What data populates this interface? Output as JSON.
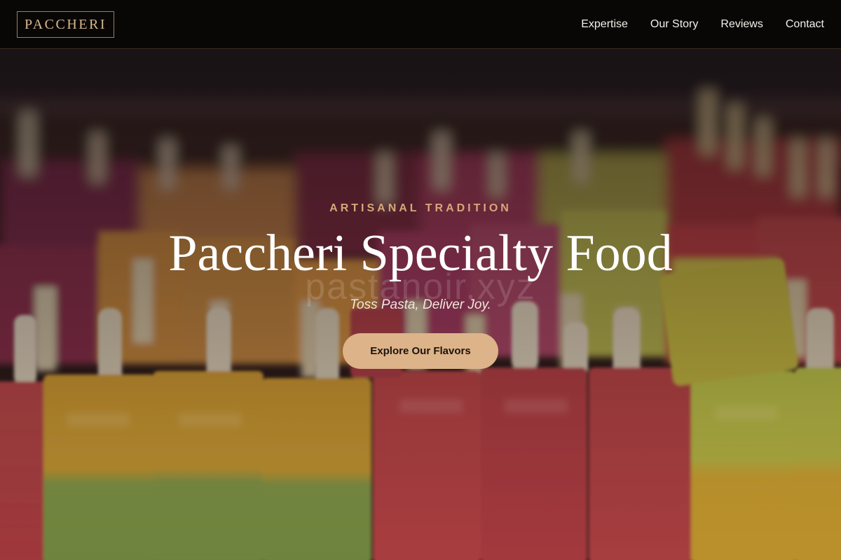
{
  "brand": {
    "logo_text": "PACCHERI"
  },
  "nav": {
    "items": [
      {
        "label": "Expertise"
      },
      {
        "label": "Our Story"
      },
      {
        "label": "Reviews"
      },
      {
        "label": "Contact"
      }
    ]
  },
  "hero": {
    "eyebrow": "ARTISANAL TRADITION",
    "title": "Paccheri Specialty Food",
    "tagline": "Toss Pasta, Deliver Joy.",
    "cta_label": "Explore Our Flavors",
    "watermark": "pastanoir.xyz",
    "background_image": "blurred-popsicles-photo"
  },
  "colors": {
    "header_bg": "#090706",
    "accent": "#ddb38a",
    "eyebrow": "#d6a878",
    "logo": "#d8b88f"
  }
}
